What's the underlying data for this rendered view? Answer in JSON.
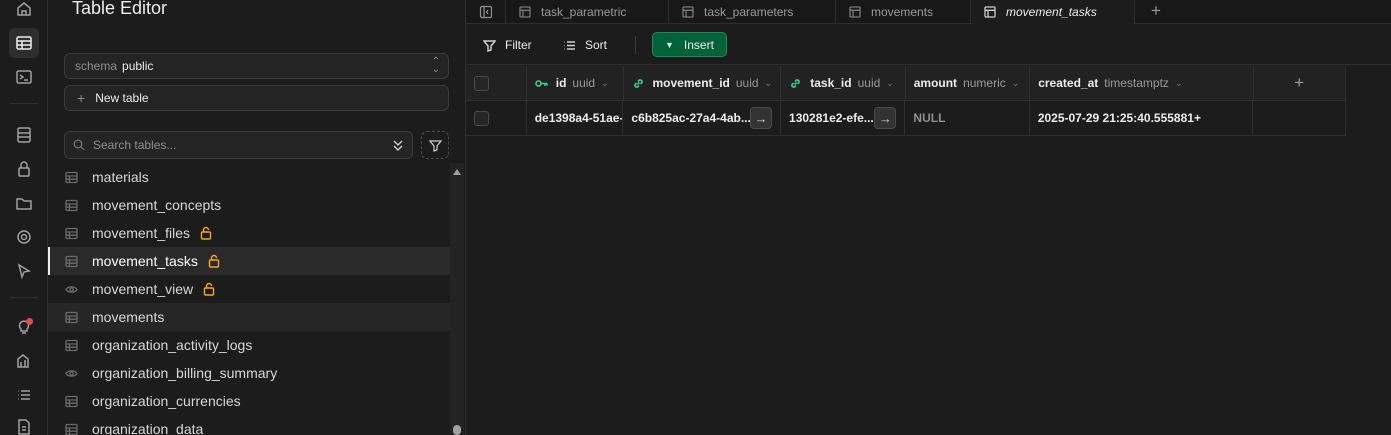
{
  "rail": {
    "icons": [
      "home-icon",
      "table-editor-icon",
      "sql-editor-icon",
      "database-icon",
      "auth-lock-icon",
      "storage-folder-icon",
      "realtime-icon",
      "cursor-icon",
      "advisor-bulb-icon",
      "reports-icon",
      "logs-list-icon",
      "docs-icon"
    ]
  },
  "sidebar": {
    "title": "Table Editor",
    "schema_label": "schema",
    "schema_value": "public",
    "new_table": "New table",
    "search_placeholder": "Search tables...",
    "tables": [
      {
        "name": "materials",
        "kind": "table",
        "locked": false
      },
      {
        "name": "movement_concepts",
        "kind": "table",
        "locked": false
      },
      {
        "name": "movement_files",
        "kind": "table",
        "locked": true
      },
      {
        "name": "movement_tasks",
        "kind": "table",
        "locked": true,
        "selected": true
      },
      {
        "name": "movement_view",
        "kind": "view",
        "locked": true
      },
      {
        "name": "movements",
        "kind": "table",
        "locked": false
      },
      {
        "name": "organization_activity_logs",
        "kind": "table",
        "locked": false
      },
      {
        "name": "organization_billing_summary",
        "kind": "view",
        "locked": false
      },
      {
        "name": "organization_currencies",
        "kind": "table",
        "locked": false
      },
      {
        "name": "organization_data",
        "kind": "table",
        "locked": false
      }
    ]
  },
  "tabs": [
    {
      "label": "task_parametric",
      "active": false
    },
    {
      "label": "task_parameters",
      "active": false
    },
    {
      "label": "movements",
      "active": false
    },
    {
      "label": "movement_tasks",
      "active": true
    }
  ],
  "toolbar": {
    "filter": "Filter",
    "sort": "Sort",
    "insert": "Insert"
  },
  "grid": {
    "columns": [
      {
        "name": "id",
        "type": "uuid",
        "icon": "key-icon"
      },
      {
        "name": "movement_id",
        "type": "uuid",
        "icon": "link-icon"
      },
      {
        "name": "task_id",
        "type": "uuid",
        "icon": "link-icon"
      },
      {
        "name": "amount",
        "type": "numeric",
        "icon": ""
      },
      {
        "name": "created_at",
        "type": "timestamptz",
        "icon": ""
      }
    ],
    "rows": [
      [
        "de1398a4-51ae-4",
        "c6b825ac-27a4-4ab...",
        "130281e2-efe...",
        "NULL",
        "2025-07-29 21:25:40.555881+"
      ]
    ]
  },
  "colors": {
    "accent_green": "#3ecf8e",
    "insert_bg": "#006239",
    "lock_orange": "#f5a524",
    "notification_red": "#e5484d"
  }
}
